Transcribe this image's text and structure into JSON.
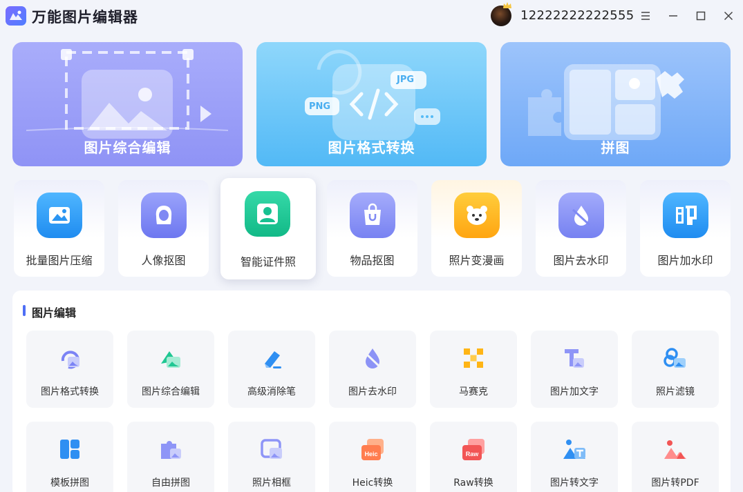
{
  "app": {
    "title": "万能图片编辑器"
  },
  "user": {
    "id": "12222222222555"
  },
  "big_cards": [
    {
      "label": "图片综合编辑"
    },
    {
      "label": "图片格式转换",
      "badges": [
        "PNG",
        "JPG"
      ]
    },
    {
      "label": "拼图"
    }
  ],
  "tools": [
    {
      "label": "批量图片压缩",
      "icon": "image-compress-icon",
      "color": "#2f9bf5"
    },
    {
      "label": "人像抠图",
      "icon": "portrait-cutout-icon",
      "color": "#7b86f4"
    },
    {
      "label": "智能证件照",
      "icon": "id-photo-icon",
      "color": "#1ec99a"
    },
    {
      "label": "物品抠图",
      "icon": "shopping-bag-icon",
      "color": "#8a92f5"
    },
    {
      "label": "照片变漫画",
      "icon": "bear-icon",
      "color": "#ffb21f"
    },
    {
      "label": "图片去水印",
      "icon": "eraser-drop-icon",
      "color": "#8c96f6"
    },
    {
      "label": "图片加水印",
      "icon": "stamp-icon",
      "color": "#2a9df4"
    }
  ],
  "section": {
    "title": "图片编辑",
    "items": [
      {
        "label": "图片格式转换",
        "icon": "format-convert-icon"
      },
      {
        "label": "图片综合编辑",
        "icon": "image-edit-icon"
      },
      {
        "label": "高级消除笔",
        "icon": "eraser-pen-icon"
      },
      {
        "label": "图片去水印",
        "icon": "remove-watermark-icon"
      },
      {
        "label": "马赛克",
        "icon": "mosaic-icon"
      },
      {
        "label": "图片加文字",
        "icon": "add-text-icon"
      },
      {
        "label": "照片滤镜",
        "icon": "filter-icon"
      },
      {
        "label": "模板拼图",
        "icon": "template-collage-icon"
      },
      {
        "label": "自由拼图",
        "icon": "puzzle-icon"
      },
      {
        "label": "照片相框",
        "icon": "photo-frame-icon"
      },
      {
        "label": "Heic转换",
        "icon": "heic-icon",
        "badge": "Heic"
      },
      {
        "label": "Raw转换",
        "icon": "raw-icon",
        "badge": "Raw"
      },
      {
        "label": "图片转文字",
        "icon": "image-to-text-icon"
      },
      {
        "label": "图片转PDF",
        "icon": "image-to-pdf-icon"
      }
    ]
  }
}
